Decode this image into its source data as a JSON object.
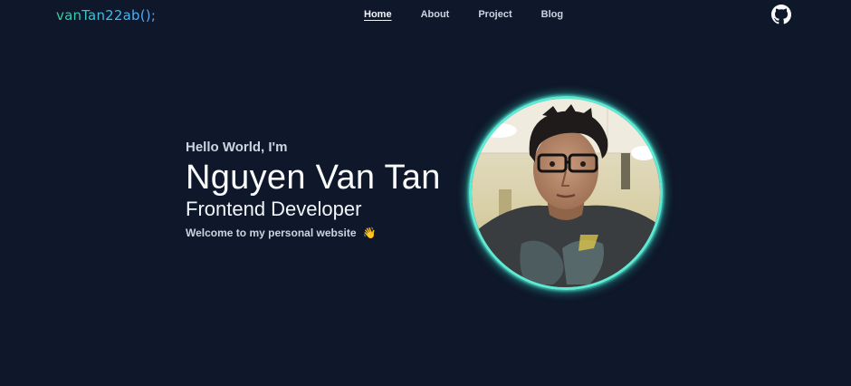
{
  "header": {
    "logo": "vanTan22ab();",
    "nav": [
      {
        "label": "Home",
        "active": true
      },
      {
        "label": "About",
        "active": false
      },
      {
        "label": "Project",
        "active": false
      },
      {
        "label": "Blog",
        "active": false
      }
    ],
    "github_icon": "github-icon"
  },
  "hero": {
    "greeting": "Hello World, I'm",
    "name": "Nguyen Van Tan",
    "role": "Frontend Developer",
    "welcome": "Welcome to my personal website",
    "welcome_emoji": "👋",
    "avatar_icon": "profile-photo"
  },
  "colors": {
    "background": "#0f172a",
    "accent_glow": "#5eead4",
    "logo_gradient_start": "#34d399",
    "logo_gradient_end": "#60a5fa"
  }
}
